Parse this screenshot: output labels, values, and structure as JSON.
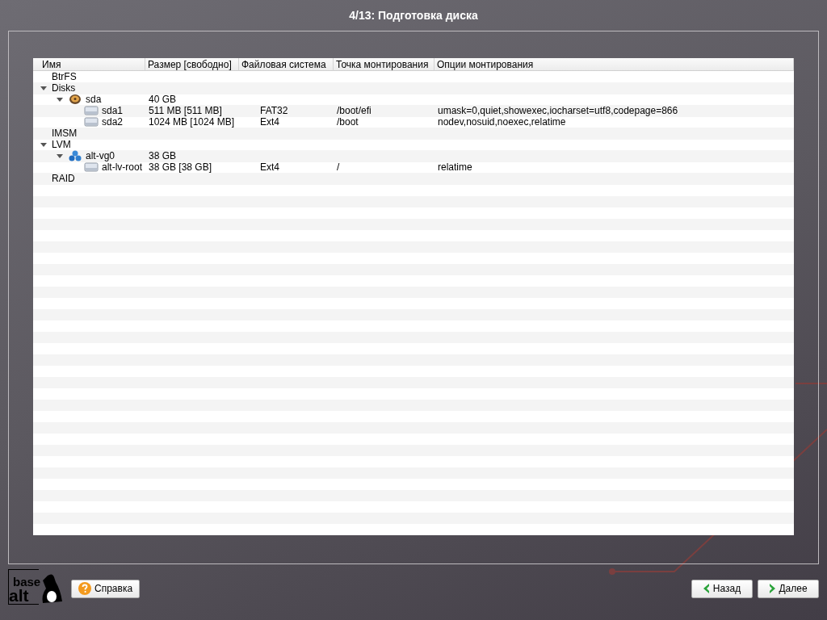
{
  "window": {
    "title": "4/13: Подготовка диска"
  },
  "table": {
    "columns": [
      "Имя",
      "Размер [свободно]",
      "Файловая система",
      "Точка монтирования",
      "Опции монтирования"
    ],
    "rows": [
      {
        "kind": "group",
        "name": "BtrFS"
      },
      {
        "kind": "group",
        "name": "Disks",
        "expanded": true,
        "children": [
          {
            "kind": "disk",
            "name": "sda",
            "size": "40 GB",
            "expanded": true,
            "children": [
              {
                "kind": "partition",
                "name": "sda1",
                "size": "511 MB [511 MB]",
                "fs": "FAT32",
                "mount": "/boot/efi",
                "options": "umask=0,quiet,showexec,iocharset=utf8,codepage=866"
              },
              {
                "kind": "partition",
                "name": "sda2",
                "size": "1024 MB [1024 MB]",
                "fs": "Ext4",
                "mount": "/boot",
                "options": "nodev,nosuid,noexec,relatime"
              }
            ]
          }
        ]
      },
      {
        "kind": "group",
        "name": "IMSM"
      },
      {
        "kind": "group",
        "name": "LVM",
        "expanded": true,
        "children": [
          {
            "kind": "volume-group",
            "name": "alt-vg0",
            "size": "38 GB",
            "expanded": true,
            "children": [
              {
                "kind": "partition",
                "name": "alt-lv-root",
                "size": "38 GB [38 GB]",
                "fs": "Ext4",
                "mount": "/",
                "options": "relatime"
              }
            ]
          }
        ]
      },
      {
        "kind": "group",
        "name": "RAID"
      }
    ]
  },
  "logo": {
    "top": "base",
    "bottom": "alt"
  },
  "buttons": [
    {
      "kind": "help",
      "label": "Справка"
    },
    {
      "kind": "back",
      "label": "Назад"
    },
    {
      "kind": "next",
      "label": "Далее"
    }
  ]
}
